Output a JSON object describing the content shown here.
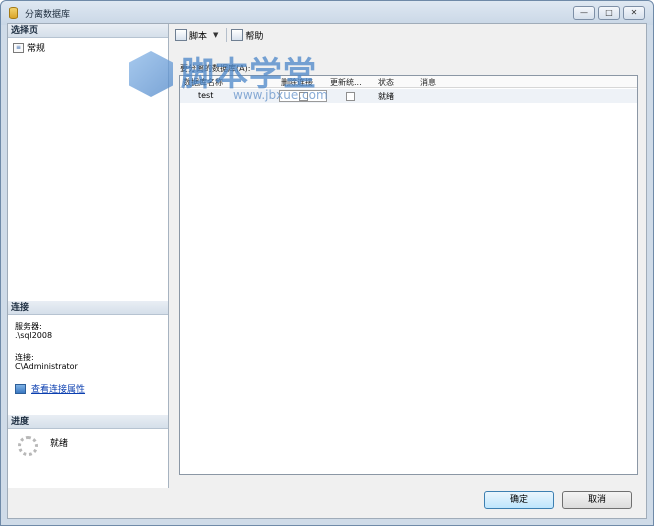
{
  "window": {
    "title": "分离数据库",
    "controls": [
      "—",
      "□",
      "✕"
    ]
  },
  "sidebar": {
    "select_page": {
      "header": "选择页",
      "items": [
        {
          "label": "常规"
        }
      ]
    },
    "connection": {
      "header": "连接",
      "server_label": "服务器:",
      "server_value": ".\\sql2008",
      "connection_label": "连接:",
      "connection_value": "C\\Administrator",
      "view_props_link": "查看连接属性"
    },
    "progress": {
      "header": "进度",
      "status": "就绪"
    }
  },
  "toolbar": {
    "script_label": "脚本",
    "help_label": "帮助"
  },
  "main": {
    "grid_label": "要分离的数据库(A):",
    "columns": [
      "数据库名称",
      "删除连接",
      "更新统...",
      "状态",
      "消息"
    ],
    "rows": [
      {
        "database": "test",
        "drop_connections": false,
        "update_stats": false,
        "status": "就绪",
        "message": ""
      }
    ]
  },
  "footer": {
    "ok_label": "确定",
    "cancel_label": "取消"
  },
  "watermark": {
    "text": "脚本学堂",
    "url": "www.jbxue.com"
  }
}
